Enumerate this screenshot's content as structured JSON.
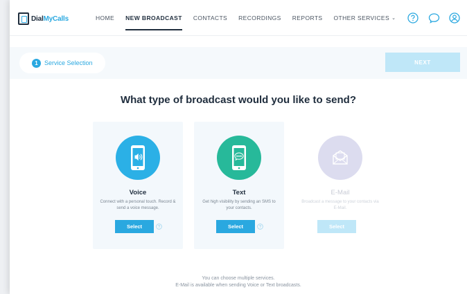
{
  "logo": {
    "prefix": "Dial",
    "accent": "MyCalls"
  },
  "nav": {
    "items": [
      {
        "label": "HOME",
        "active": false
      },
      {
        "label": "NEW BROADCAST",
        "active": true
      },
      {
        "label": "CONTACTS",
        "active": false
      },
      {
        "label": "RECORDINGS",
        "active": false
      },
      {
        "label": "REPORTS",
        "active": false
      },
      {
        "label": "OTHER SERVICES",
        "active": false
      }
    ],
    "icons": [
      "help-icon",
      "chat-icon",
      "user-icon"
    ]
  },
  "step": {
    "number": "1",
    "label": "Service Selection"
  },
  "next_label": "NEXT",
  "question": "What type of broadcast would you like to send?",
  "cards": {
    "voice": {
      "title": "Voice",
      "desc": "Connect with a personal touch. Record & send a voice message.",
      "button": "Select",
      "icon": "phone-speaker-icon"
    },
    "text": {
      "title": "Text",
      "desc": "Get high visibility by sending an SMS to your contacts.",
      "button": "Select",
      "icon": "phone-sms-icon"
    },
    "email": {
      "title": "E-Mail",
      "desc": "Broadcast a message to your contacts via E-Mail.",
      "button": "Select",
      "icon": "envelope-icon"
    }
  },
  "footnote": {
    "line1": "You can choose multiple services.",
    "line2": "E-Mail is available when sending Voice or Text broadcasts."
  },
  "colors": {
    "accent": "#2aa8e0",
    "text_green": "#27b99a",
    "disabled": "#bfe7f8",
    "dark": "#1f2d3d"
  }
}
